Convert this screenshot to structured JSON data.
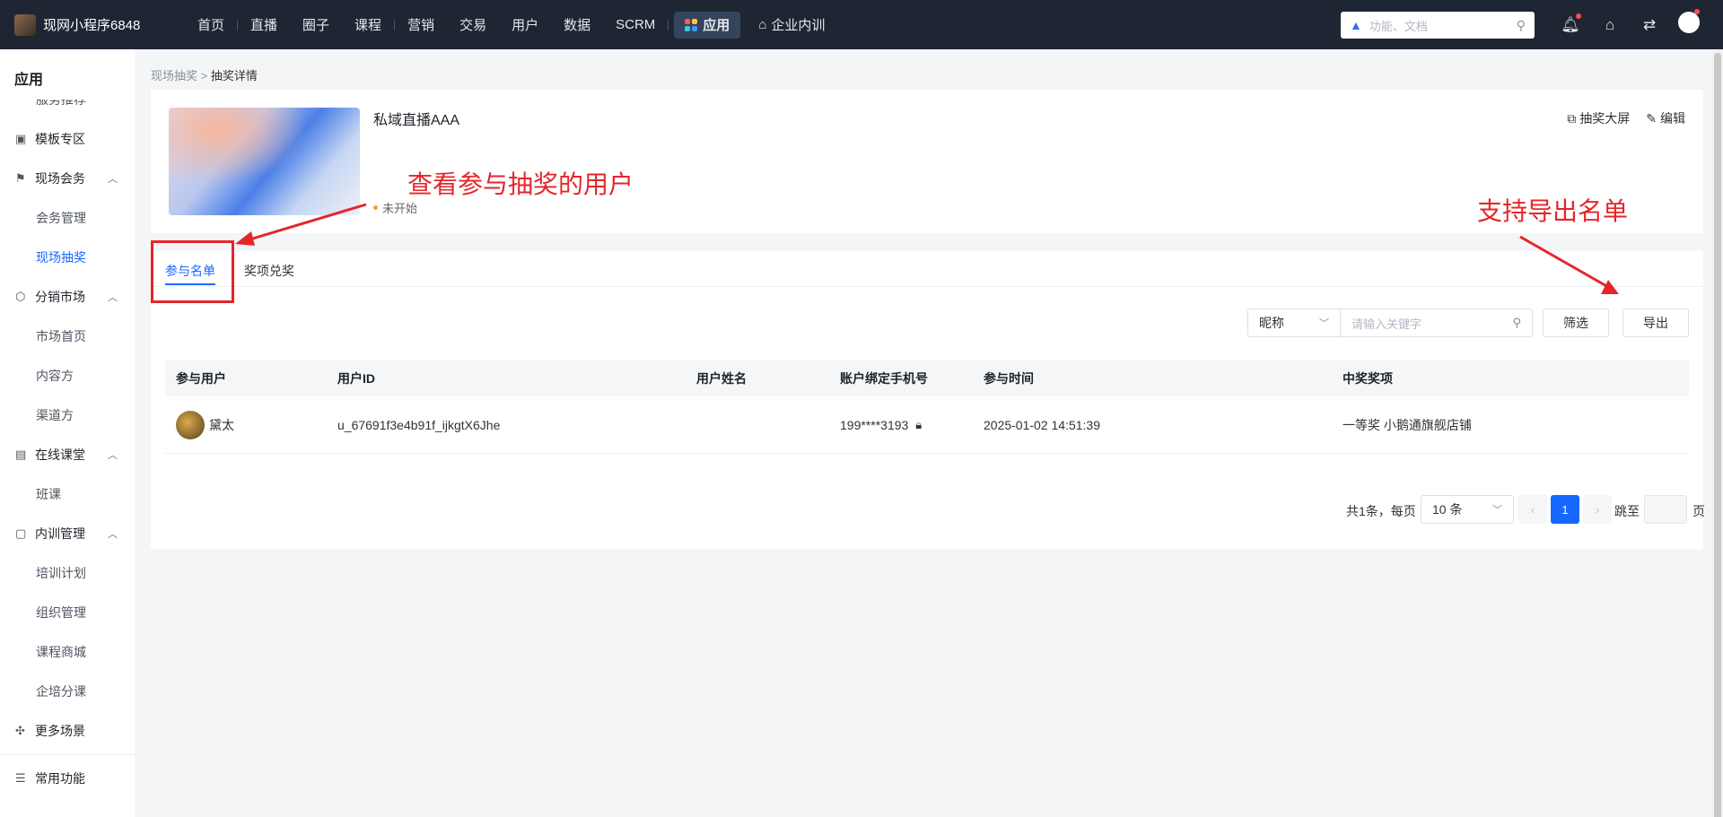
{
  "brand": {
    "name": "现网小程序6848"
  },
  "nav": {
    "items": [
      "首页",
      "直播",
      "圈子",
      "课程",
      "营销",
      "交易",
      "用户",
      "数据",
      "SCRM"
    ],
    "active": "应用",
    "extra": "企业内训"
  },
  "search": {
    "placeholder": "功能、文档"
  },
  "sidebar": {
    "title": "应用",
    "cut_item": "服务推荐",
    "template": "模板专区",
    "g1": {
      "label": "现场会务",
      "items": [
        "会务管理",
        "现场抽奖"
      ]
    },
    "g2": {
      "label": "分销市场",
      "items": [
        "市场首页",
        "内容方",
        "渠道方"
      ]
    },
    "g3": {
      "label": "在线课堂",
      "items": [
        "班课"
      ]
    },
    "g4": {
      "label": "内训管理",
      "items": [
        "培训计划",
        "组织管理",
        "课程商城",
        "企培分课"
      ]
    },
    "more": "更多场景",
    "common": "常用功能"
  },
  "breadcrumb": {
    "parent": "现场抽奖",
    "current": "抽奖详情"
  },
  "event": {
    "title": "私域直播AAA",
    "status": "未开始",
    "screen_btn": "抽奖大屏",
    "edit_btn": "编辑"
  },
  "tabs": {
    "participants": "参与名单",
    "redeem": "奖项兑奖"
  },
  "filter": {
    "select": "昵称",
    "placeholder": "请输入关键字",
    "filter_btn": "筛选",
    "export_btn": "导出"
  },
  "table": {
    "headers": [
      "参与用户",
      "用户ID",
      "用户姓名",
      "账户绑定手机号",
      "参与时间",
      "中奖奖项"
    ],
    "rows": [
      {
        "nick": "黛太",
        "uid": "u_67691f3e4b91f_ijkgtX6Jhe",
        "name": "",
        "phone": "199****3193",
        "time": "2025-01-02 14:51:39",
        "prize": "一等奖 小鹅通旗舰店铺"
      }
    ]
  },
  "pagination": {
    "total": "共1条，每页",
    "page_size": "10 条",
    "current": "1",
    "jump": "跳至",
    "page": "页"
  },
  "annotations": {
    "view_users": "查看参与抽奖的用户",
    "export_list": "支持导出名单"
  },
  "colors": {
    "primary": "#1668ff",
    "topbar": "#1f2633",
    "annotation": "#e4262a"
  }
}
